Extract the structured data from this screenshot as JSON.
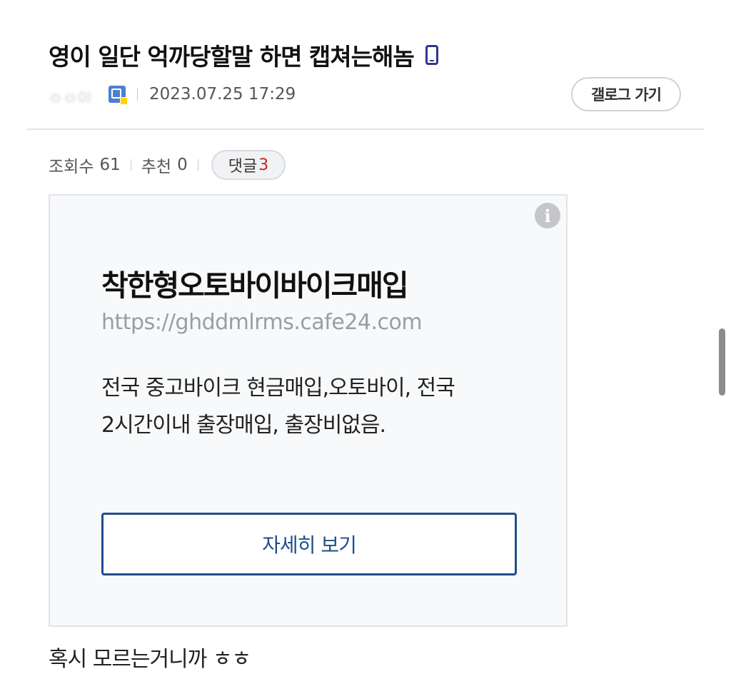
{
  "post": {
    "title": "영이 일단 억까당할말 하면 캡쳐는해놈",
    "author_masked": "ㅇㅇ이",
    "date": "2023.07.25 17:29",
    "gallery_button": "갤로그 가기",
    "views_label": "조회수",
    "views": "61",
    "recommend_label": "추천",
    "recommend": "0",
    "comments_label": "댓글",
    "comments": "3",
    "body": "혹시 모르는거니까 ㅎㅎ"
  },
  "ad": {
    "title": "착한형오토바이바이크매입",
    "url": "https://ghddmlrms.cafe24.com",
    "description_line1": "전국 중고바이크 현금매입,오토바이, 전국",
    "description_line2": "2시간이내 출장매입, 출장비없음.",
    "button": "자세히 보기",
    "info_icon": "i"
  },
  "icons": {
    "mobile": "mobile-phone-icon",
    "nick": "nick-badge-icon",
    "info": "info-icon"
  },
  "colors": {
    "accent": "#1f4f8a",
    "comment_count": "#c0281e",
    "mobile_icon": "#2b3a8c"
  }
}
